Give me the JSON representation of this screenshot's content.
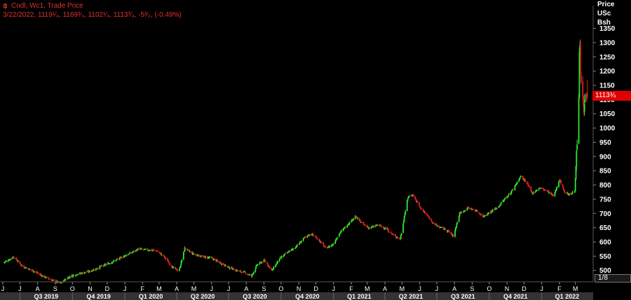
{
  "legend": {
    "series_name": "Cndl, Wc1, Trade Price",
    "last_bar": "3/22/2022, 1119¹⁄₄, 1169³⁄₄, 1102¹⁄₄, 1113³⁄₄, -5³⁄₂, (-0.49%)"
  },
  "price_axis": {
    "title_lines": [
      "Price",
      "USc",
      "Bsh"
    ],
    "last_price_tag": "1113¾",
    "scale_label": "1/8"
  },
  "colors": {
    "up": "#2ee82e",
    "down": "#e02020",
    "background": "#000000",
    "grid": "#2a2a2a",
    "axis_text": "#ffffff",
    "quarter_bar": "#333333"
  },
  "chart_data": {
    "type": "candlestick",
    "title": "",
    "ylabel": "Price USc Bsh",
    "ylim": [
      460,
      1430
    ],
    "y_ticks": [
      500,
      550,
      600,
      650,
      700,
      750,
      800,
      850,
      900,
      950,
      1000,
      1050,
      1100,
      1150,
      1200,
      1250,
      1300,
      1350
    ],
    "grid": false,
    "x_range": [
      "2019-06",
      "2022-03-22"
    ],
    "month_ticks": [
      "J",
      "J",
      "A",
      "S",
      "O",
      "N",
      "D",
      "J",
      "F",
      "M",
      "A",
      "M",
      "J",
      "J",
      "A",
      "S",
      "O",
      "N",
      "D",
      "J",
      "F",
      "M",
      "A",
      "M",
      "J",
      "J",
      "A",
      "S",
      "O",
      "N",
      "D",
      "J",
      "F",
      "M"
    ],
    "quarter_labels": [
      "Q3 2019",
      "Q4 2019",
      "Q1 2020",
      "Q2 2020",
      "Q3 2020",
      "Q4 2020",
      "Q1 2021",
      "Q2 2021",
      "Q3 2021",
      "Q4 2021",
      "Q1 2022"
    ],
    "close_path": [
      [
        "2019-06-03",
        528
      ],
      [
        "2019-06-20",
        548
      ],
      [
        "2019-07-05",
        515
      ],
      [
        "2019-07-25",
        498
      ],
      [
        "2019-08-10",
        480
      ],
      [
        "2019-08-28",
        465
      ],
      [
        "2019-09-10",
        455
      ],
      [
        "2019-09-25",
        478
      ],
      [
        "2019-10-10",
        488
      ],
      [
        "2019-10-28",
        495
      ],
      [
        "2019-11-10",
        505
      ],
      [
        "2019-11-25",
        518
      ],
      [
        "2019-12-10",
        530
      ],
      [
        "2019-12-28",
        548
      ],
      [
        "2020-01-10",
        560
      ],
      [
        "2020-01-25",
        575
      ],
      [
        "2020-02-10",
        572
      ],
      [
        "2020-02-25",
        570
      ],
      [
        "2020-03-10",
        548
      ],
      [
        "2020-03-25",
        510
      ],
      [
        "2020-04-05",
        498
      ],
      [
        "2020-04-15",
        578
      ],
      [
        "2020-04-28",
        560
      ],
      [
        "2020-05-15",
        548
      ],
      [
        "2020-05-30",
        545
      ],
      [
        "2020-06-15",
        528
      ],
      [
        "2020-06-30",
        512
      ],
      [
        "2020-07-15",
        500
      ],
      [
        "2020-07-30",
        492
      ],
      [
        "2020-08-10",
        480
      ],
      [
        "2020-08-20",
        520
      ],
      [
        "2020-09-02",
        535
      ],
      [
        "2020-09-15",
        500
      ],
      [
        "2020-09-28",
        540
      ],
      [
        "2020-10-10",
        560
      ],
      [
        "2020-10-25",
        580
      ],
      [
        "2020-11-10",
        612
      ],
      [
        "2020-11-22",
        630
      ],
      [
        "2020-12-05",
        610
      ],
      [
        "2020-12-18",
        578
      ],
      [
        "2020-12-30",
        590
      ],
      [
        "2021-01-12",
        632
      ],
      [
        "2021-01-25",
        660
      ],
      [
        "2021-02-08",
        690
      ],
      [
        "2021-02-20",
        665
      ],
      [
        "2021-03-05",
        648
      ],
      [
        "2021-03-20",
        660
      ],
      [
        "2021-04-02",
        648
      ],
      [
        "2021-04-15",
        625
      ],
      [
        "2021-04-28",
        610
      ],
      [
        "2021-05-06",
        700
      ],
      [
        "2021-05-12",
        760
      ],
      [
        "2021-05-20",
        765
      ],
      [
        "2021-06-02",
        720
      ],
      [
        "2021-06-15",
        690
      ],
      [
        "2021-06-28",
        660
      ],
      [
        "2021-07-08",
        650
      ],
      [
        "2021-07-20",
        640
      ],
      [
        "2021-07-30",
        620
      ],
      [
        "2021-08-10",
        700
      ],
      [
        "2021-08-25",
        720
      ],
      [
        "2021-09-08",
        710
      ],
      [
        "2021-09-20",
        690
      ],
      [
        "2021-10-02",
        705
      ],
      [
        "2021-10-15",
        720
      ],
      [
        "2021-10-28",
        750
      ],
      [
        "2021-11-10",
        780
      ],
      [
        "2021-11-25",
        830
      ],
      [
        "2021-12-05",
        810
      ],
      [
        "2021-12-15",
        770
      ],
      [
        "2021-12-28",
        790
      ],
      [
        "2022-01-10",
        780
      ],
      [
        "2022-01-22",
        760
      ],
      [
        "2022-02-01",
        820
      ],
      [
        "2022-02-10",
        775
      ],
      [
        "2022-02-20",
        765
      ],
      [
        "2022-02-28",
        780
      ],
      [
        "2022-03-02",
        870
      ],
      [
        "2022-03-04",
        940
      ],
      [
        "2022-03-07",
        1100
      ],
      [
        "2022-03-08",
        1260
      ],
      [
        "2022-03-09",
        1300
      ],
      [
        "2022-03-10",
        1180
      ],
      [
        "2022-03-14",
        1110
      ],
      [
        "2022-03-16",
        1050
      ],
      [
        "2022-03-18",
        1130
      ],
      [
        "2022-03-22",
        1113.75
      ]
    ],
    "last_bar": {
      "date": "2022-03-22",
      "open": 1119.25,
      "high": 1169.75,
      "low": 1102.25,
      "close": 1113.75,
      "change": -5.5,
      "change_pct": -0.49
    }
  }
}
